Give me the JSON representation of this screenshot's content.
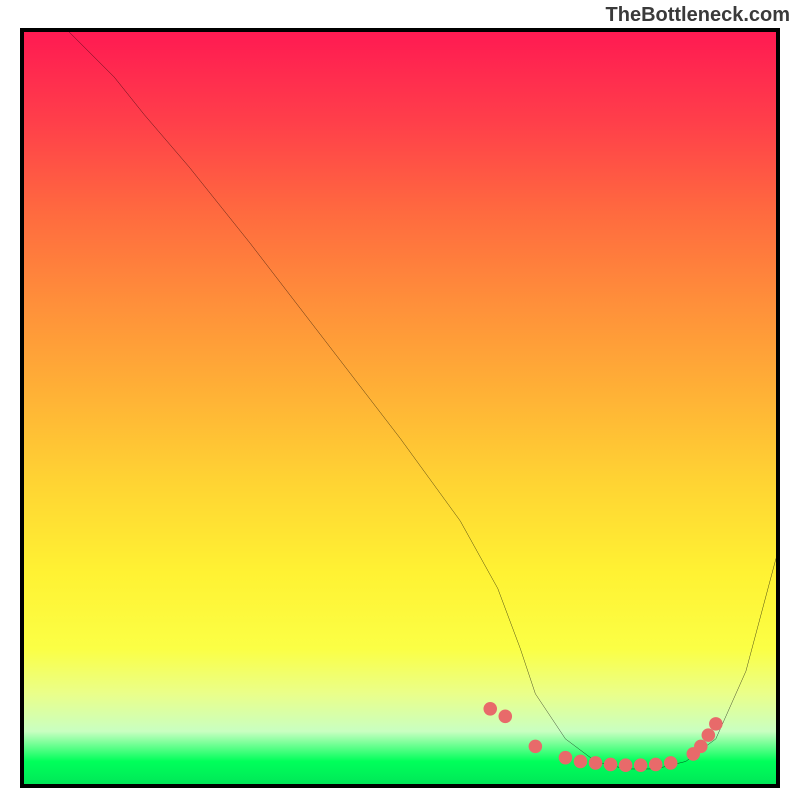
{
  "watermark": "TheBottleneck.com",
  "chart_data": {
    "type": "line",
    "title": "",
    "xlabel": "",
    "ylabel": "",
    "xlim": [
      0,
      100
    ],
    "ylim": [
      0,
      100
    ],
    "series": [
      {
        "name": "curve",
        "x": [
          6,
          8,
          12,
          16,
          22,
          30,
          40,
          50,
          58,
          63,
          66,
          68,
          72,
          76,
          80,
          84,
          88,
          92,
          96,
          100
        ],
        "y": [
          100,
          98,
          94,
          89,
          82,
          72,
          59,
          46,
          35,
          26,
          18,
          12,
          6,
          3,
          2,
          2,
          3,
          6,
          15,
          30
        ]
      },
      {
        "name": "dots",
        "x": [
          62,
          64,
          68,
          72,
          74,
          76,
          78,
          80,
          82,
          84,
          86,
          89,
          90,
          91,
          92
        ],
        "y": [
          10,
          9,
          5,
          3.5,
          3,
          2.8,
          2.6,
          2.5,
          2.5,
          2.6,
          2.8,
          4,
          5,
          6.5,
          8
        ]
      }
    ],
    "colors": {
      "curve": "#000000",
      "dots": "#e86a6a",
      "gradient_top": "#ff1a52",
      "gradient_bottom": "#00e858",
      "frame": "#000000"
    }
  }
}
